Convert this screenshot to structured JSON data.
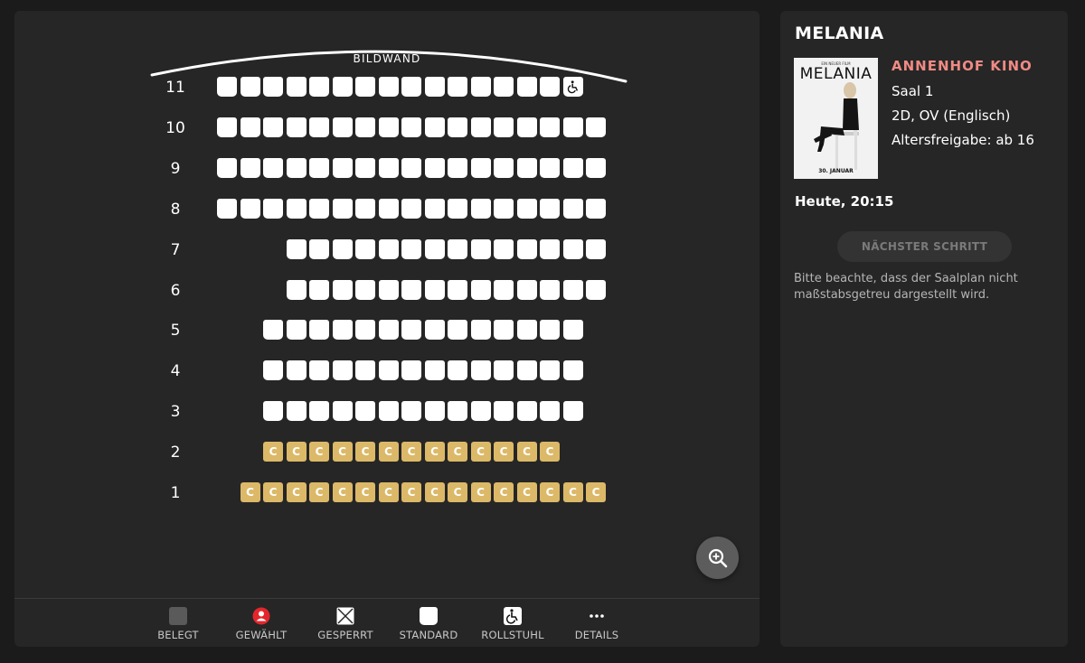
{
  "seat_plan": {
    "screen_label": "BILDWAND",
    "rows": [
      {
        "label": "11",
        "type": "standard",
        "start": 0,
        "count": 15,
        "wheelchair_end": true
      },
      {
        "label": "10",
        "type": "standard",
        "start": 0,
        "count": 17
      },
      {
        "label": "9",
        "type": "standard",
        "start": 0,
        "count": 17
      },
      {
        "label": "8",
        "type": "standard",
        "start": 0,
        "count": 17
      },
      {
        "label": "7",
        "type": "standard",
        "start": 3,
        "count": 14
      },
      {
        "label": "6",
        "type": "standard",
        "start": 3,
        "count": 14
      },
      {
        "label": "5",
        "type": "standard",
        "start": 2,
        "count": 14
      },
      {
        "label": "4",
        "type": "standard",
        "start": 2,
        "count": 14
      },
      {
        "label": "3",
        "type": "standard",
        "start": 2,
        "count": 14
      },
      {
        "label": "2",
        "type": "comfort",
        "start": 2,
        "count": 13
      },
      {
        "label": "1",
        "type": "comfort",
        "start": 1,
        "count": 16
      }
    ],
    "comfort_letter": "C",
    "colors": {
      "standard": "#ffffff",
      "comfort": "#dcb968",
      "selected": "#e3262c",
      "occupied": "#5a5a5a"
    }
  },
  "legend": [
    {
      "key": "occupied",
      "label": "BELEGT"
    },
    {
      "key": "selected",
      "label": "GEWÄHLT"
    },
    {
      "key": "blocked",
      "label": "GESPERRT"
    },
    {
      "key": "standard",
      "label": "STANDARD"
    },
    {
      "key": "wheelchair",
      "label": "ROLLSTUHL"
    },
    {
      "key": "details",
      "label": "DETAILS"
    }
  ],
  "info": {
    "title": "MELANIA",
    "poster": {
      "tagline": "EIN NEUER FILM",
      "title": "MELANIA",
      "date": "30. JANUAR"
    },
    "cinema": "ANNENHOF KINO",
    "hall": "Saal 1",
    "format": "2D, OV (Englisch)",
    "age_rating": "Altersfreigabe: ab 16",
    "showtime": "Heute, 20:15",
    "next_button": "NÄCHSTER SCHRITT",
    "note": "Bitte beachte, dass der Saalplan nicht maßstabsgetreu dargestellt wird."
  }
}
